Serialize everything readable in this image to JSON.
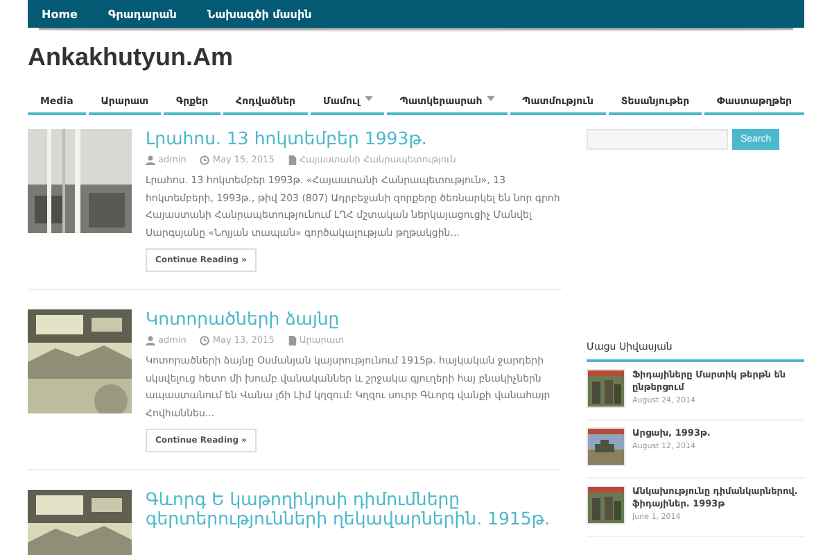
{
  "top_menu": [
    {
      "label": "Home"
    },
    {
      "label": "Գրադարան"
    },
    {
      "label": "Նախագծի մասին"
    }
  ],
  "site_title": "Ankakhutyun.Am",
  "main_menu": [
    {
      "label": "Media",
      "has_submenu": false
    },
    {
      "label": "Արարատ",
      "has_submenu": false
    },
    {
      "label": "Գրքեր",
      "has_submenu": false
    },
    {
      "label": "Հոդվածներ",
      "has_submenu": false
    },
    {
      "label": "Մամուլ",
      "has_submenu": true
    },
    {
      "label": "Պատկերասրահ",
      "has_submenu": true
    },
    {
      "label": "Պատմություն",
      "has_submenu": false
    },
    {
      "label": "Տեսանյութեր",
      "has_submenu": false
    },
    {
      "label": "Փաստաթղթեր",
      "has_submenu": false
    }
  ],
  "posts": [
    {
      "title": "Լրահոս. 13 հոկտեմբեր 1993թ.",
      "author": "admin",
      "date": "May 15, 2015",
      "category": "Հայաստանի Հանրապետություն",
      "excerpt": "Լրահոս. 13 հոկտեմբեր 1993թ. «Հայաստանի Հանրապետություն», 13 հոկտեմբերի, 1993թ., թիվ 203 (807) Ադրբեջանի զորքերը ծեռնարկել են նոր գրոհ Հայաստանի Հանրապետությունում ԼՂՀ մշտական ներկայացուցիչ Մանվել Սարգսյանը «Նոյյան տապան» գործակալության թղթակցին...",
      "button": "Continue Reading »"
    },
    {
      "title": "Կոտորածների ձայնը",
      "author": "admin",
      "date": "May 13, 2015",
      "category": "Արարատ",
      "excerpt": "Կոտորածների ձայնը Օսմանյան կայսրությունում 1915թ. հայկական ջարդերի սկսվելուց հետո մի խումբ վանականներ և շրջակա գյուղերի հայ բնակիչներն ապաստանում են Վանա լճի Լիմ կղզում: Կղզու սուրբ Գևորգ վանքի վանահայր Հովհաննես...",
      "button": "Continue Reading »"
    },
    {
      "title": "Գևորգ Ե կաթողիկոսի դիմումները գերտերությունների ղեկավարներին. 1915թ."
    }
  ],
  "search": {
    "button": "Search"
  },
  "sidebar": {
    "heading": "Մացս Սիվասյան",
    "items": [
      {
        "title": "Ֆիդայիները Մարտիկ թերթն են ընթերցում",
        "date": "August 24, 2014"
      },
      {
        "title": "Արցախ, 1993թ.",
        "date": "August 12, 2014"
      },
      {
        "title": "Անկախությունը դիմանկարներով. ֆիդայիներ. 1993թ",
        "date": "June 1, 2014"
      }
    ]
  }
}
